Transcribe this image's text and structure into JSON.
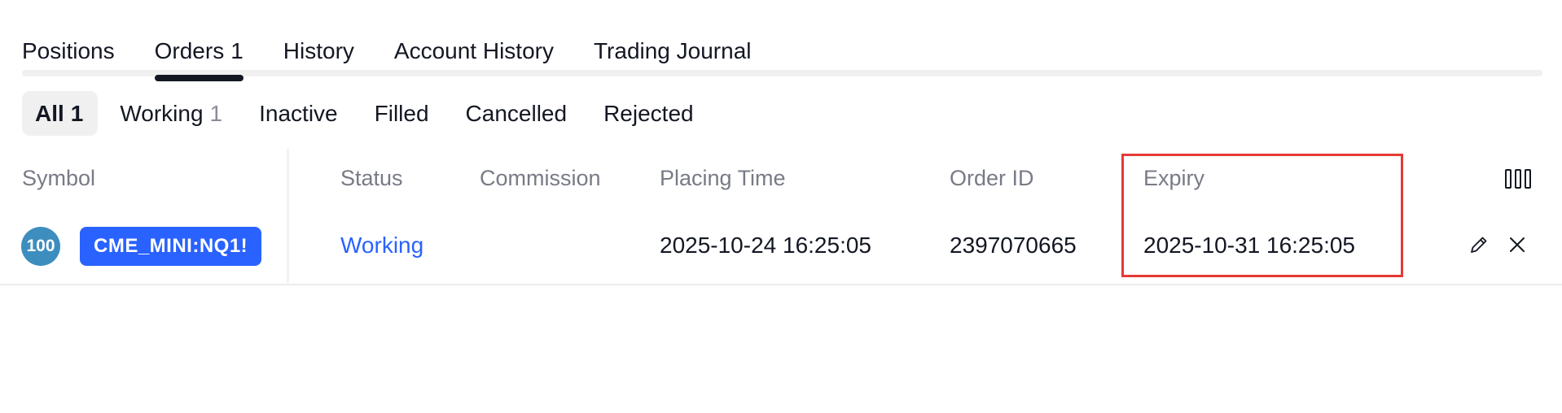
{
  "tabs": [
    {
      "label": "Positions",
      "count": ""
    },
    {
      "label": "Orders",
      "count": "1"
    },
    {
      "label": "History",
      "count": ""
    },
    {
      "label": "Account History",
      "count": ""
    },
    {
      "label": "Trading Journal",
      "count": ""
    }
  ],
  "active_tab": "Orders",
  "filters": [
    {
      "label": "All",
      "count": "1"
    },
    {
      "label": "Working",
      "count": "1"
    },
    {
      "label": "Inactive",
      "count": ""
    },
    {
      "label": "Filled",
      "count": ""
    },
    {
      "label": "Cancelled",
      "count": ""
    },
    {
      "label": "Rejected",
      "count": ""
    }
  ],
  "active_filter": "All",
  "table": {
    "headers": {
      "symbol": "Symbol",
      "status": "Status",
      "commission": "Commission",
      "placing_time": "Placing Time",
      "order_id": "Order ID",
      "expiry": "Expiry"
    },
    "rows": [
      {
        "qty": "100",
        "symbol": "CME_MINI:NQ1!",
        "status": "Working",
        "commission": "",
        "placing_time": "2025-10-24 16:25:05",
        "order_id": "2397070665",
        "expiry": "2025-10-31 16:25:05"
      }
    ]
  },
  "icons": {
    "columns": "columns-settings-icon",
    "edit": "pencil-icon",
    "cancel": "close-icon"
  },
  "colors": {
    "accent": "#2962ff",
    "qty_badge": "#3d8ebf",
    "highlight": "#e53935",
    "header_text": "#787b86",
    "text": "#131722"
  }
}
